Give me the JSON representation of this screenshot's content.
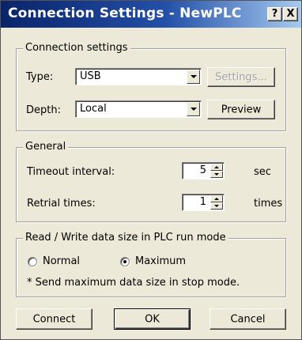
{
  "window": {
    "title": "Connection Settings - NewPLC",
    "help_glyph": "?",
    "close_glyph": "X"
  },
  "connection": {
    "legend": "Connection settings",
    "type_label": "Type:",
    "type_value": "USB",
    "settings_button": "Settings...",
    "depth_label": "Depth:",
    "depth_value": "Local",
    "preview_button": "Preview"
  },
  "general": {
    "legend": "General",
    "timeout_label": "Timeout interval:",
    "timeout_value": "5",
    "timeout_unit": "sec",
    "retrial_label": "Retrial times:",
    "retrial_value": "1",
    "retrial_unit": "times"
  },
  "datasize": {
    "legend": "Read / Write data size in PLC run mode",
    "normal_label": "Normal",
    "maximum_label": "Maximum",
    "selected": "Maximum",
    "note": "* Send maximum data size in stop mode."
  },
  "footer": {
    "connect_button": "Connect",
    "ok_button": "OK",
    "cancel_button": "Cancel"
  },
  "icons": {
    "dropdown": "chevron-down-icon",
    "spin_up": "spin-up-icon",
    "spin_down": "spin-down-icon",
    "help": "help-icon",
    "close": "close-icon"
  }
}
